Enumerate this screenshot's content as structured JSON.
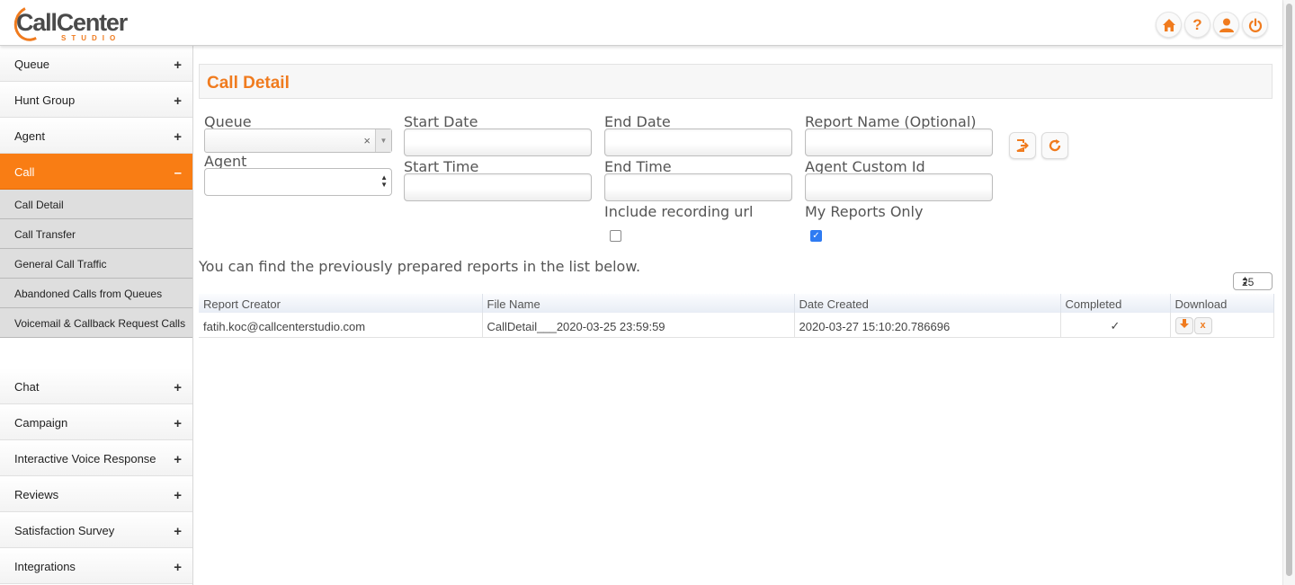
{
  "logo": {
    "main": "CallCenter",
    "sub": "STUDIO"
  },
  "header_icons": [
    {
      "name": "home-icon",
      "glyph": "⌂"
    },
    {
      "name": "help-icon",
      "glyph": "?"
    },
    {
      "name": "user-icon",
      "glyph": "👤"
    },
    {
      "name": "power-icon",
      "glyph": "⏻"
    }
  ],
  "sidebar": {
    "top_items": [
      {
        "label": "Queue",
        "toggle": "+"
      },
      {
        "label": "Hunt Group",
        "toggle": "+"
      },
      {
        "label": "Agent",
        "toggle": "+"
      },
      {
        "label": "Call",
        "toggle": "–"
      }
    ],
    "sub_items": [
      {
        "label": "Call Detail"
      },
      {
        "label": "Call Transfer"
      },
      {
        "label": "General Call Traffic"
      },
      {
        "label": "Abandoned Calls from Queues"
      },
      {
        "label": "Voicemail & Callback Request Calls"
      }
    ],
    "bottom_items": [
      {
        "label": "Chat",
        "toggle": "+"
      },
      {
        "label": "Campaign",
        "toggle": "+"
      },
      {
        "label": "Interactive Voice Response",
        "toggle": "+"
      },
      {
        "label": "Reviews",
        "toggle": "+"
      },
      {
        "label": "Satisfaction Survey",
        "toggle": "+"
      },
      {
        "label": "Integrations",
        "toggle": "+"
      }
    ]
  },
  "page": {
    "title": "Call Detail",
    "form": {
      "queue_label": "Queue",
      "queue_clear": "×",
      "agent_label": "Agent",
      "start_date_label": "Start Date",
      "start_time_label": "Start Time",
      "end_date_label": "End Date",
      "end_time_label": "End Time",
      "report_name_label": "Report Name (Optional)",
      "agent_custom_id_label": "Agent Custom Id",
      "include_recording_label": "Include recording url",
      "include_recording_checked": false,
      "my_reports_label": "My Reports Only",
      "my_reports_checked": true
    },
    "info_text": "You can find the previously prepared reports in the list below.",
    "page_size": "25",
    "table": {
      "columns": [
        "Report Creator",
        "File Name",
        "Date Created",
        "Completed",
        "Download"
      ],
      "rows": [
        {
          "creator": "fatih.koc@callcenterstudio.com",
          "file_name": "CallDetail___2020-03-25 23:59:59",
          "date_created": "2020-03-27 15:10:20.786696",
          "completed": "✓",
          "download_delete": "x"
        }
      ]
    }
  },
  "colors": {
    "accent": "#f97d14",
    "title": "#f07b1e"
  }
}
